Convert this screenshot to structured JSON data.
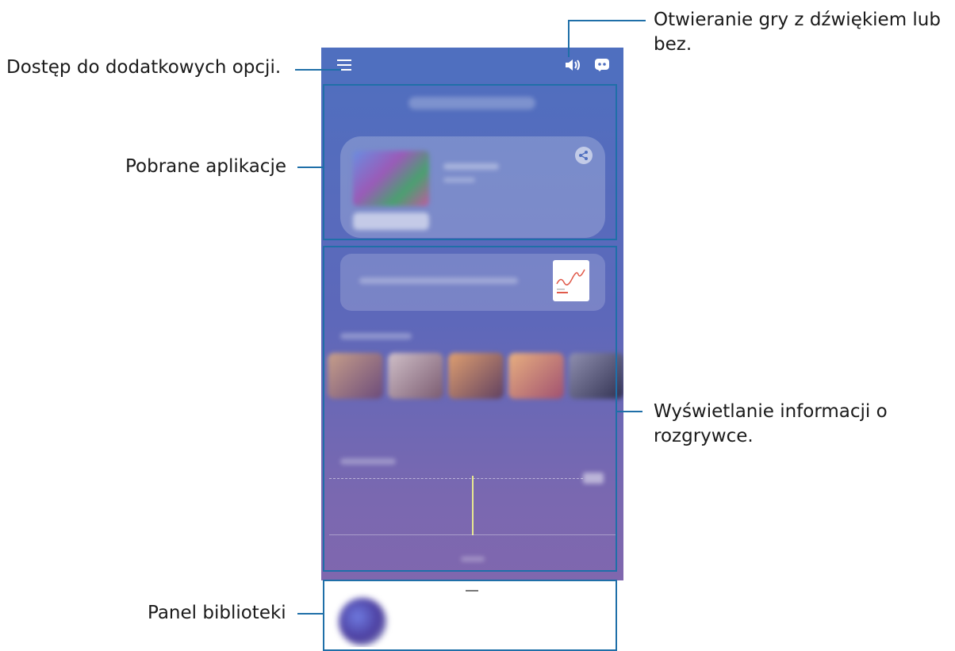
{
  "callouts": {
    "menu": "Dostęp do dodatkowych opcji.",
    "apps": "Pobrane aplikacje",
    "sound_line1": "Otwieranie gry z dźwiękiem lub",
    "sound_line2": "bez.",
    "info_line1": "Wyświetlanie informacji o",
    "info_line2": "rozgrywce.",
    "library": "Panel biblioteki"
  },
  "icons": {
    "menu": "menu-icon",
    "sound": "speaker-icon",
    "discord": "discord-icon",
    "share": "share-icon",
    "chart": "chart-icon"
  },
  "colors": {
    "callout_line": "#1f6fa8",
    "topbar": "#4f6fbf",
    "screen_top": "#4f6fbf",
    "screen_bottom": "#8466ad"
  }
}
